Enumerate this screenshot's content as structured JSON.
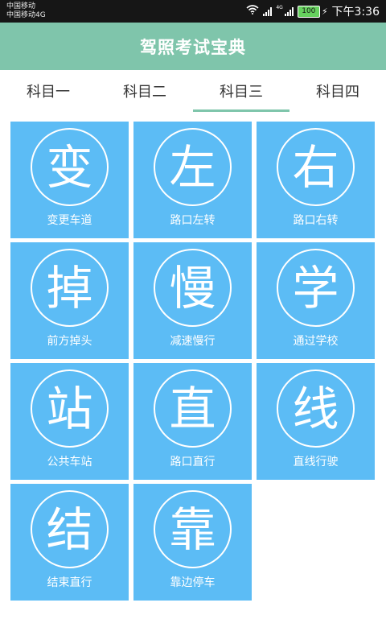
{
  "status_bar": {
    "carrier_1": "中国移动",
    "carrier_2": "中国移动4G",
    "signal_small": "4G",
    "battery": "100",
    "time": "下午3:36"
  },
  "header": {
    "title": "驾照考试宝典"
  },
  "tabs": [
    {
      "label": "科目一"
    },
    {
      "label": "科目二"
    },
    {
      "label": "科目三"
    },
    {
      "label": "科目四"
    }
  ],
  "active_tab": 2,
  "items": [
    {
      "char": "变",
      "label": "变更车道"
    },
    {
      "char": "左",
      "label": "路口左转"
    },
    {
      "char": "右",
      "label": "路口右转"
    },
    {
      "char": "掉",
      "label": "前方掉头"
    },
    {
      "char": "慢",
      "label": "减速慢行"
    },
    {
      "char": "学",
      "label": "通过学校"
    },
    {
      "char": "站",
      "label": "公共车站"
    },
    {
      "char": "直",
      "label": "路口直行"
    },
    {
      "char": "线",
      "label": "直线行驶"
    },
    {
      "char": "结",
      "label": "结束直行"
    },
    {
      "char": "靠",
      "label": "靠边停车"
    }
  ],
  "colors": {
    "accent": "#7fc5ab",
    "card": "#5cbcf5"
  }
}
